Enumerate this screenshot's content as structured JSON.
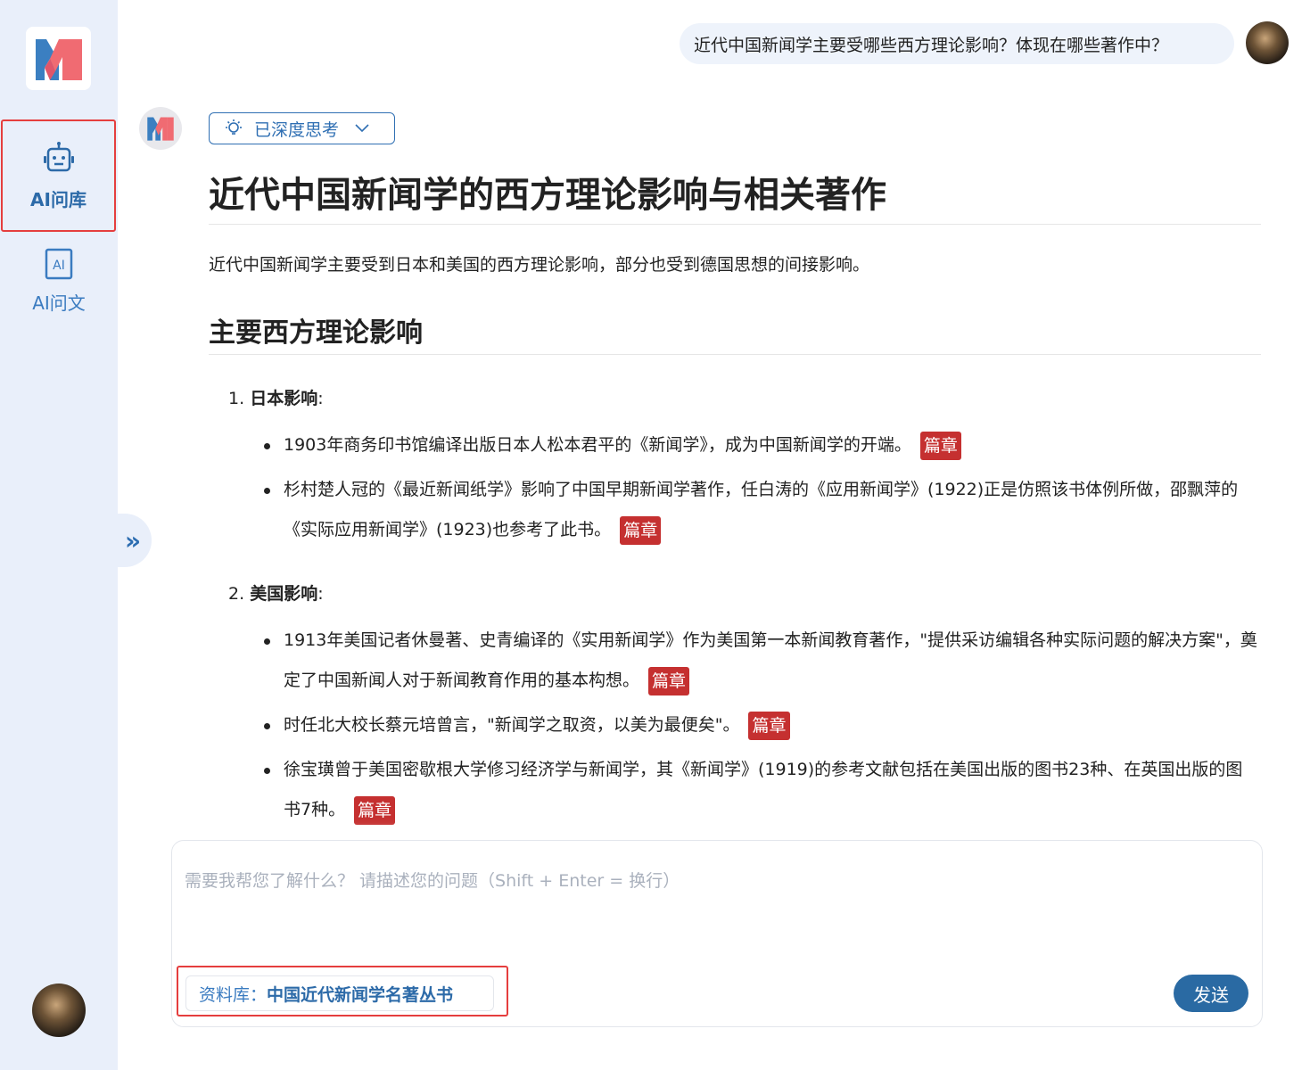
{
  "sidebar": {
    "logo_letter": "M",
    "items": [
      {
        "label": "AI问库",
        "icon": "robot-icon",
        "active": true
      },
      {
        "label": "AI问文",
        "icon": "ai-doc-icon",
        "active": false
      }
    ],
    "collapse_glyph": "»"
  },
  "chat": {
    "user_question": "近代中国新闻学主要受哪些西方理论影响？体现在哪些著作中？",
    "thinking_label": "已深度思考",
    "title": "近代中国新闻学的西方理论影响与相关著作",
    "intro": "近代中国新闻学主要受到日本和美国的西方理论影响，部分也受到德国思想的间接影响。",
    "section_title": "主要西方理论影响",
    "sections": [
      {
        "number": "1.",
        "heading": "日本影响",
        "colon": ":",
        "bullets": [
          "1903年商务印书馆编译出版日本人松本君平的《新闻学》，成为中国新闻学的开端。",
          "杉村楚人冠的《最近新闻纸学》影响了中国早期新闻学著作，任白涛的《应用新闻学》(1922)正是仿照该书体例所做，邵飘萍的《实际应用新闻学》(1923)也参考了此书。"
        ]
      },
      {
        "number": "2.",
        "heading": "美国影响",
        "colon": ":",
        "bullets": [
          "1913年美国记者休曼著、史青编译的《实用新闻学》作为美国第一本新闻教育著作，\"提供采访编辑各种实际问题的解决方案\"，奠定了中国新闻人对于新闻教育作用的基本构想。",
          "时任北大校长蔡元培曾言，\"新闻学之取资，以美为最便矣\"。",
          "徐宝璜曾于美国密歇根大学修习经济学与新闻学，其《新闻学》(1919)的参考文献包括在美国出版的图书23种、在英国出版的图书7种。"
        ]
      }
    ],
    "source_tag": "篇章"
  },
  "input": {
    "placeholder": "需要我帮您了解什么？ 请描述您的问题（Shift + Enter = 换行）",
    "library_key": "资料库：",
    "library_value": "中国近代新闻学名著丛书",
    "send_label": "发送"
  },
  "colors": {
    "sidebar_bg": "#e9effa",
    "accent": "#2a6aa3",
    "tag_red": "#c53030",
    "highlight_red": "#e53e3e"
  }
}
